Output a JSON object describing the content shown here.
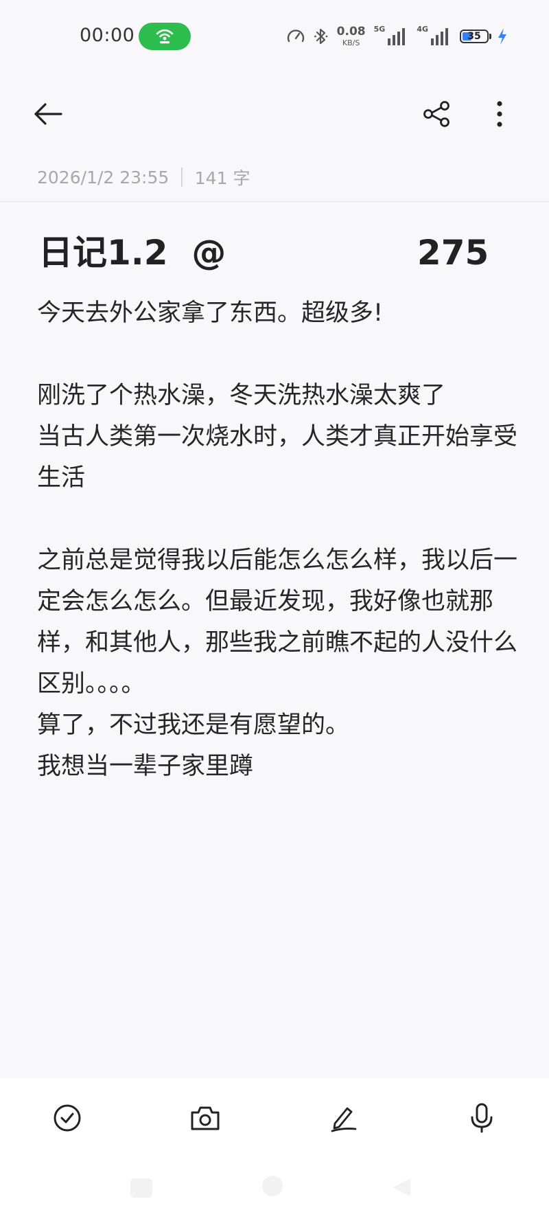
{
  "status_bar": {
    "time": "00:00",
    "net_speed_value": "0.08",
    "net_speed_unit": "KB/S",
    "signal_1_label": "5G",
    "signal_2_label": "4G",
    "battery_level": "35",
    "hotspot_color": "#2dbd4e",
    "battery_fill_color": "#3b7ff5",
    "charging_color": "#3b7ff5"
  },
  "toolbar": {
    "back_icon": "arrow-left",
    "share_icon": "share",
    "more_icon": "more-vertical"
  },
  "meta": {
    "datetime": "2026/1/2 23:55",
    "word_count": "141 字"
  },
  "note": {
    "title": "日记1.2  @                275",
    "body": [
      "今天去外公家拿了东西。超级多!",
      "",
      "刚洗了个热水澡，冬天洗热水澡太爽了",
      "当古人类第一次烧水时，人类才真正开始享受生活",
      "",
      "之前总是觉得我以后能怎么怎么样，我以后一定会怎么怎么。但最近发现，我好像也就那样，和其他人，那些我之前瞧不起的人没什么区别。。。。",
      "算了，不过我还是有愿望的。",
      "我想当一辈子家里蹲"
    ]
  },
  "bottom_tools": {
    "checklist_icon": "check-circle",
    "camera_icon": "camera",
    "handwriting_icon": "pen",
    "voice_icon": "microphone"
  }
}
